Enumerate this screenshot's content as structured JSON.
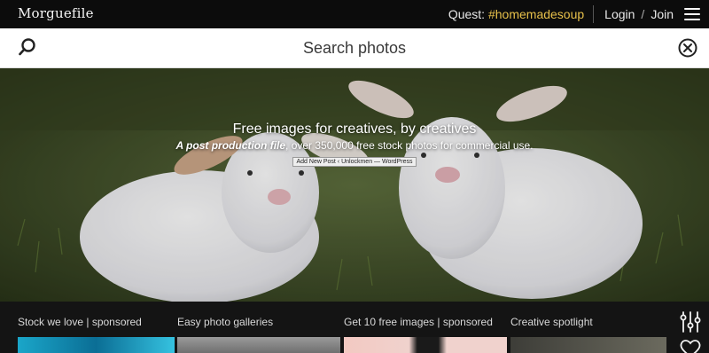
{
  "brand": "Morguefile",
  "quest": {
    "label": "Quest:",
    "tag": "#homemadesoup"
  },
  "auth": {
    "login": "Login",
    "separator": "/",
    "join": "Join"
  },
  "search": {
    "placeholder": "Search photos"
  },
  "hero": {
    "title": "Free images for creatives, by creatives",
    "subtitle_em": "A post production file",
    "subtitle_rest": ", over 350,000 free stock photos for commercial use.",
    "tooltip": "Add New Post ‹ Unlockmen — WordPress"
  },
  "sections": [
    {
      "label": "Stock we love | sponsored"
    },
    {
      "label": "Easy photo galleries"
    },
    {
      "label": "Get 10 free images | sponsored"
    },
    {
      "label": "Creative spotlight"
    }
  ],
  "icons": {
    "search": "search-icon",
    "close": "close-circle-icon",
    "menu": "hamburger-menu-icon",
    "filter": "sliders-icon",
    "favorite": "heart-icon"
  },
  "colors": {
    "topbar": "#0c0c0c",
    "accent_tag": "#e7c04a",
    "bottom_bg": "#141414"
  }
}
